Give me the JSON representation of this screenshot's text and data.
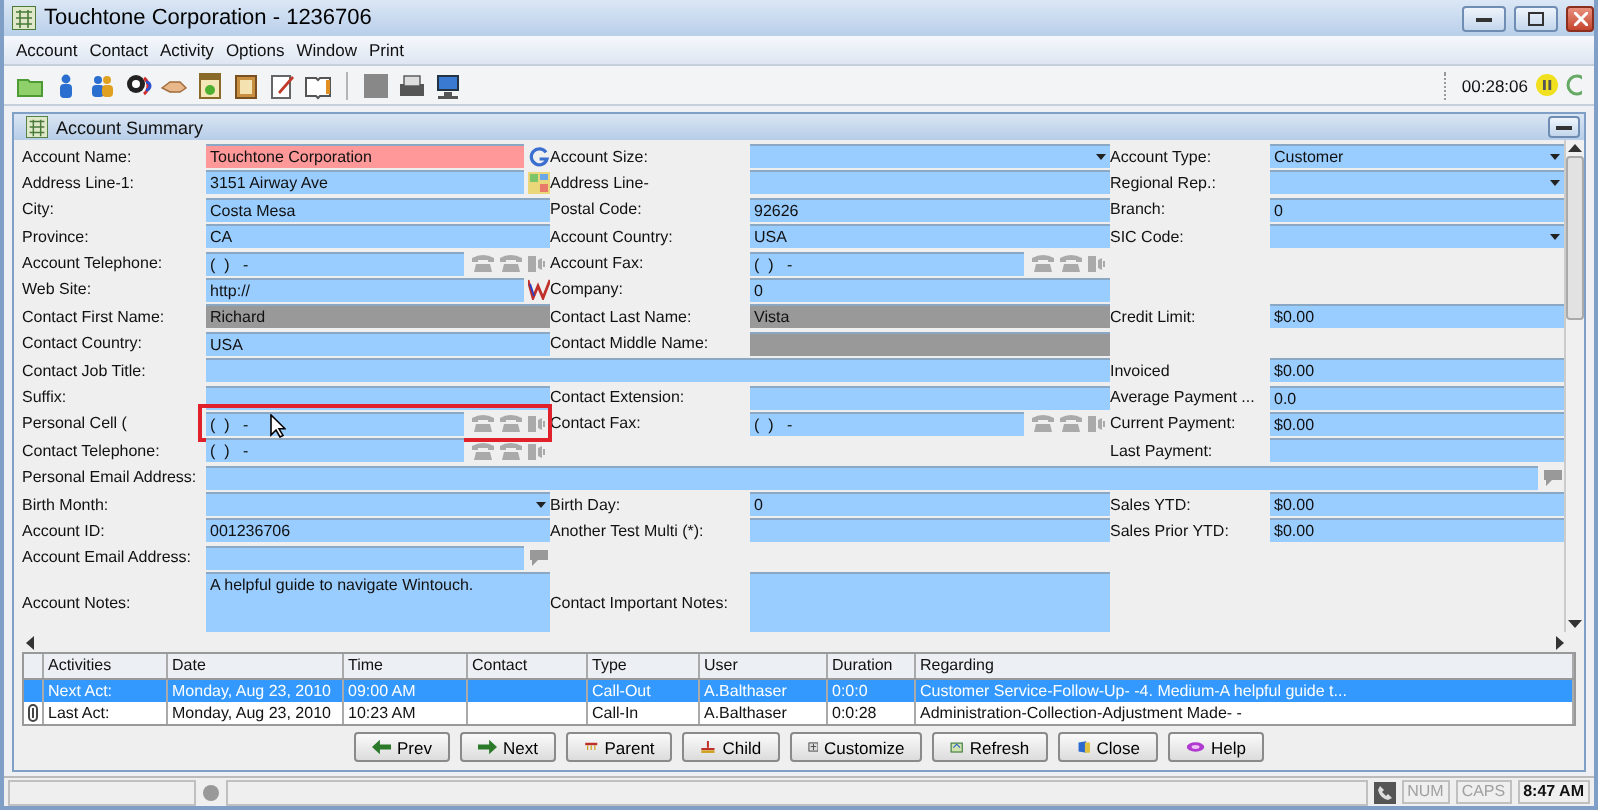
{
  "window": {
    "title": "Touchtone Corporation - 1236706"
  },
  "menu": [
    "Account",
    "Contact",
    "Activity",
    "Options",
    "Window",
    "Print"
  ],
  "toolbar": {
    "timer": "00:28:06"
  },
  "panel": {
    "title": "Account Summary"
  },
  "form": {
    "rows": [
      {
        "left": {
          "label": "Account Name:",
          "value": "Touchtone Corporation",
          "kind": "name",
          "required": true,
          "readonly": false
        },
        "middle": {
          "label": "Account Size:",
          "kind": "dropdown",
          "required": false,
          "readonly": false
        },
        "right": {
          "label": "Account Type:",
          "value": "Customer",
          "kind": "dropdown",
          "required": false,
          "readonly": false
        }
      },
      {
        "left": {
          "label": "Address Line-1:",
          "value": "3151 Airway Ave",
          "kind": "address",
          "required": false,
          "readonly": false
        },
        "middle": {
          "label": "Address Line-",
          "kind": "text",
          "required": false,
          "readonly": false
        },
        "right": {
          "label": "Regional Rep.:",
          "kind": "dropdown",
          "required": false,
          "readonly": false
        }
      },
      {
        "left": {
          "label": "City:",
          "value": "Costa Mesa",
          "kind": "text",
          "required": false,
          "readonly": false
        },
        "middle": {
          "label": "Postal Code:",
          "value": "92626",
          "kind": "text",
          "required": false,
          "readonly": false
        },
        "right": {
          "label": "Branch:",
          "value": "0",
          "kind": "text",
          "required": false,
          "readonly": false
        }
      },
      {
        "left": {
          "label": "Province:",
          "value": "CA",
          "kind": "text",
          "required": false,
          "readonly": false
        },
        "middle": {
          "label": "Account Country:",
          "value": "USA",
          "kind": "text",
          "required": false,
          "readonly": false
        },
        "right": {
          "label": "SIC Code:",
          "kind": "dropdown",
          "required": false,
          "readonly": false
        }
      },
      {
        "left": {
          "label": "Account Telephone:",
          "value": "(  )   -",
          "kind": "phone",
          "required": false,
          "readonly": false
        },
        "middle": {
          "label": "Account Fax:",
          "value": "(  )   -",
          "kind": "phone",
          "required": false,
          "readonly": false
        }
      },
      {
        "left": {
          "label": "Web Site:",
          "value": "http://",
          "kind": "website",
          "required": false,
          "readonly": false
        },
        "middle": {
          "label": "Company:",
          "value": "0",
          "kind": "text",
          "required": false,
          "readonly": false
        }
      },
      {
        "left": {
          "label": "Contact First Name:",
          "value": "Richard",
          "kind": "text",
          "required": false,
          "readonly": true
        },
        "middle": {
          "label": "Contact Last Name:",
          "value": "Vista",
          "kind": "text",
          "required": false,
          "readonly": true
        },
        "right": {
          "label": "Credit Limit:",
          "value": "$0.00",
          "kind": "text",
          "required": false,
          "readonly": false
        }
      },
      {
        "left": {
          "label": "Contact Country:",
          "value": "USA",
          "kind": "text",
          "required": false,
          "readonly": false
        },
        "middle": {
          "label": "Contact Middle Name:",
          "kind": "text",
          "required": false,
          "readonly": true
        }
      },
      {
        "left": {
          "label": "Contact Job Title:",
          "kind": "long",
          "required": false,
          "readonly": false
        },
        "right": {
          "label": "Invoiced",
          "value": "$0.00",
          "kind": "text",
          "required": false,
          "readonly": false
        }
      },
      {
        "left": {
          "label": "Suffix:",
          "kind": "text",
          "required": false,
          "readonly": false
        },
        "middle": {
          "label": "Contact Extension:",
          "kind": "text",
          "required": false,
          "readonly": false
        },
        "right": {
          "label": "Average Payment ...",
          "value": "0.0",
          "kind": "text",
          "required": false,
          "readonly": false
        }
      },
      {
        "left": {
          "label": "Personal Cell (",
          "value": "(  )   -",
          "kind": "phone",
          "required": false,
          "readonly": false,
          "outlined": true
        },
        "middle": {
          "label": "Contact Fax:",
          "value": "(  )   -",
          "kind": "phone",
          "required": false,
          "readonly": false
        },
        "right": {
          "label": "Current Payment:",
          "value": "$0.00",
          "kind": "text",
          "required": false,
          "readonly": false
        }
      },
      {
        "left": {
          "label": "Contact Telephone:",
          "value": "(  )   -",
          "kind": "phone",
          "required": false,
          "readonly": false
        },
        "right": {
          "label": "Last Payment:",
          "kind": "text",
          "required": false,
          "readonly": false
        }
      },
      {
        "left": {
          "label": "Personal Email Address:",
          "kind": "long_email",
          "required": false,
          "readonly": false
        }
      },
      {
        "left": {
          "label": "Birth Month:",
          "kind": "dropdown",
          "required": false,
          "readonly": false
        },
        "middle": {
          "label": "Birth Day:",
          "value": "0",
          "kind": "text",
          "required": false,
          "readonly": false
        },
        "right": {
          "label": "Sales YTD:",
          "value": "$0.00",
          "kind": "text",
          "required": false,
          "readonly": false
        }
      },
      {
        "left": {
          "label": "Account ID:",
          "value": "001236706",
          "kind": "text",
          "required": false,
          "readonly": false
        },
        "middle": {
          "label": "Another Test Multi (*):",
          "kind": "text",
          "required": false,
          "readonly": false
        },
        "right": {
          "label": "Sales Prior YTD:",
          "value": "$0.00",
          "kind": "text",
          "required": false,
          "readonly": false
        }
      },
      {
        "left": {
          "label": "Account Email Address:",
          "kind": "email",
          "required": false,
          "readonly": false
        }
      },
      {
        "left": {
          "label": "Account Notes:",
          "value": "A helpful guide to navigate Wintouch.",
          "kind": "notes",
          "required": false,
          "readonly": false
        },
        "middle": {
          "label": "Contact Important Notes:",
          "kind": "notes",
          "required": false,
          "readonly": false
        }
      }
    ]
  },
  "activities": {
    "columns": [
      "Activities",
      "Date",
      "Time",
      "Contact",
      "Type",
      "User",
      "Duration",
      "Regarding"
    ],
    "rows": [
      {
        "selected": true,
        "attached": false,
        "cells": [
          "Next Act:",
          "Monday, Aug 23, 2010",
          "09:00 AM",
          "",
          "Call-Out",
          "A.Balthaser",
          "0:0:0",
          "Customer Service-Follow-Up- -4. Medium-A helpful guide t..."
        ]
      },
      {
        "selected": false,
        "attached": true,
        "cells": [
          "Last Act:",
          "Monday, Aug 23, 2010",
          "10:23 AM",
          "",
          "Call-In",
          "A.Balthaser",
          "0:0:28",
          "Administration-Collection-Adjustment Made- -"
        ]
      }
    ]
  },
  "buttons": [
    "Prev",
    "Next",
    "Parent",
    "Child",
    "Customize",
    "Refresh",
    "Close",
    "Help"
  ],
  "status_bar": {
    "indicators": [
      {
        "label": "NUM",
        "active": false
      },
      {
        "label": "CAPS",
        "active": false
      }
    ],
    "time": "8:47 AM"
  }
}
